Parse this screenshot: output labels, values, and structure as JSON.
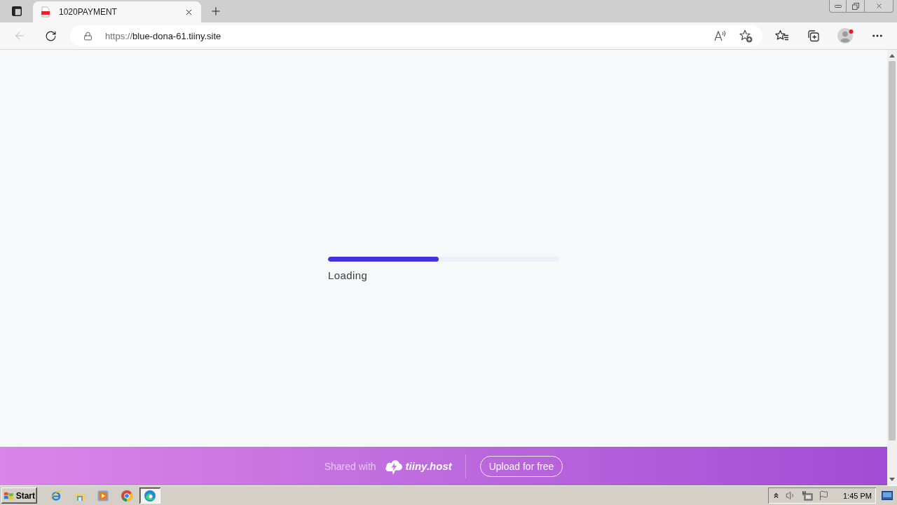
{
  "browser": {
    "tabs": [
      {
        "title": "1020PAYMENT",
        "selected": true
      }
    ],
    "back": {
      "disabled": true
    },
    "address": {
      "scheme": "https://",
      "host": "blue-dona-61.tiiny.site"
    }
  },
  "page": {
    "progress": {
      "level": 0.48,
      "label": "Loading"
    }
  },
  "banner": {
    "text": "Shared with",
    "brand": "tiiny.host",
    "button": "Upload for free"
  },
  "taskbar": {
    "start": "Start",
    "apps": [
      {
        "kind": "ie",
        "selected": false
      },
      {
        "kind": "folder",
        "selected": false
      },
      {
        "kind": "media",
        "selected": false
      },
      {
        "kind": "chrome",
        "selected": false
      },
      {
        "kind": "edge",
        "selected": true
      }
    ],
    "clock": "1:45 PM"
  }
}
